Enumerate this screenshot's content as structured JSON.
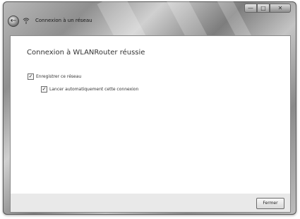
{
  "window": {
    "title": "Connexion à un réseau",
    "controls": {
      "minimize": "—",
      "maximize": "□",
      "close": "✕"
    },
    "back_glyph": "←"
  },
  "main": {
    "heading": "Connexion à WLANRouter réussie",
    "options": [
      {
        "label": "Enregistrer ce réseau",
        "checked": true,
        "check_glyph": "✓"
      },
      {
        "label": "Lancer automatiquement cette connexion",
        "checked": true,
        "check_glyph": "✓"
      }
    ]
  },
  "footer": {
    "close_label": "Fermer"
  },
  "icons": {
    "back": "back-arrow-icon",
    "network": "network-icon"
  }
}
